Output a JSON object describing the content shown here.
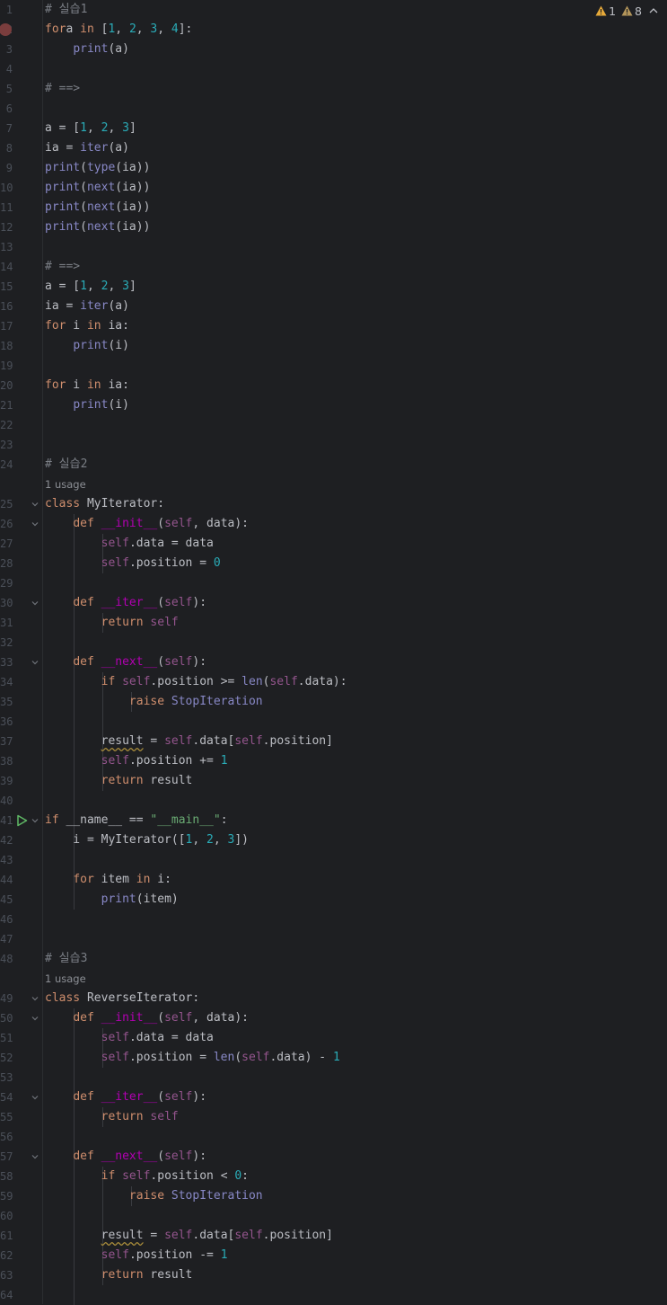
{
  "inspections": {
    "warnings": "1",
    "weak_warnings": "8"
  },
  "hints": {
    "usage": "1 usage"
  },
  "lines": [
    {
      "n": "1",
      "t": [
        [
          "cm",
          "# 실습1"
        ]
      ]
    },
    {
      "n": "2",
      "t": [
        [
          "kw",
          "for"
        ],
        [
          "",
          "a "
        ],
        [
          "kw",
          "in"
        ],
        [
          "",
          " ["
        ],
        [
          "nm",
          "1"
        ],
        [
          "",
          ", "
        ],
        [
          "nm",
          "2"
        ],
        [
          "",
          ", "
        ],
        [
          "nm",
          "3"
        ],
        [
          "",
          ", "
        ],
        [
          "nm",
          "4"
        ],
        [
          "",
          "]:"
        ]
      ]
    },
    {
      "n": "3",
      "t": [
        [
          "",
          "    "
        ],
        [
          "bi",
          "print"
        ],
        [
          "",
          "(a)"
        ]
      ]
    },
    {
      "n": "4",
      "t": []
    },
    {
      "n": "5",
      "t": [
        [
          "cm",
          "# ==>"
        ]
      ]
    },
    {
      "n": "6",
      "t": []
    },
    {
      "n": "7",
      "t": [
        [
          "",
          "a = ["
        ],
        [
          "nm",
          "1"
        ],
        [
          "",
          ", "
        ],
        [
          "nm",
          "2"
        ],
        [
          "",
          ", "
        ],
        [
          "nm",
          "3"
        ],
        [
          "",
          "]"
        ]
      ]
    },
    {
      "n": "8",
      "t": [
        [
          "",
          "ia = "
        ],
        [
          "bi",
          "iter"
        ],
        [
          "",
          "(a)"
        ]
      ]
    },
    {
      "n": "9",
      "t": [
        [
          "bi",
          "print"
        ],
        [
          "",
          "("
        ],
        [
          "bi",
          "type"
        ],
        [
          "",
          "(ia))"
        ]
      ]
    },
    {
      "n": "10",
      "t": [
        [
          "bi",
          "print"
        ],
        [
          "",
          "("
        ],
        [
          "bi",
          "next"
        ],
        [
          "",
          "(ia))"
        ]
      ]
    },
    {
      "n": "11",
      "t": [
        [
          "bi",
          "print"
        ],
        [
          "",
          "("
        ],
        [
          "bi",
          "next"
        ],
        [
          "",
          "(ia))"
        ]
      ]
    },
    {
      "n": "12",
      "t": [
        [
          "bi",
          "print"
        ],
        [
          "",
          "("
        ],
        [
          "bi",
          "next"
        ],
        [
          "",
          "(ia))"
        ]
      ]
    },
    {
      "n": "13",
      "t": []
    },
    {
      "n": "14",
      "t": [
        [
          "cm",
          "# ==>"
        ]
      ]
    },
    {
      "n": "15",
      "t": [
        [
          "",
          "a = ["
        ],
        [
          "nm",
          "1"
        ],
        [
          "",
          ", "
        ],
        [
          "nm",
          "2"
        ],
        [
          "",
          ", "
        ],
        [
          "nm",
          "3"
        ],
        [
          "",
          "]"
        ]
      ]
    },
    {
      "n": "16",
      "t": [
        [
          "",
          "ia = "
        ],
        [
          "bi",
          "iter"
        ],
        [
          "",
          "(a)"
        ]
      ]
    },
    {
      "n": "17",
      "t": [
        [
          "kw",
          "for"
        ],
        [
          "",
          " i "
        ],
        [
          "kw",
          "in"
        ],
        [
          "",
          " ia:"
        ]
      ]
    },
    {
      "n": "18",
      "t": [
        [
          "",
          "    "
        ],
        [
          "bi",
          "print"
        ],
        [
          "",
          "(i)"
        ]
      ]
    },
    {
      "n": "19",
      "t": []
    },
    {
      "n": "20",
      "t": [
        [
          "kw",
          "for"
        ],
        [
          "",
          " i "
        ],
        [
          "kw",
          "in"
        ],
        [
          "",
          " ia:"
        ]
      ]
    },
    {
      "n": "21",
      "t": [
        [
          "",
          "    "
        ],
        [
          "bi",
          "print"
        ],
        [
          "",
          "(i)"
        ]
      ]
    },
    {
      "n": "22",
      "t": []
    },
    {
      "n": "23",
      "t": []
    },
    {
      "n": "24",
      "t": [
        [
          "cm",
          "# 실습2"
        ]
      ]
    },
    {
      "n": "25",
      "t": [
        [
          "kw",
          "class"
        ],
        [
          "",
          " MyIterator:"
        ]
      ]
    },
    {
      "n": "26",
      "t": [
        [
          "",
          "    "
        ],
        [
          "kw",
          "def"
        ],
        [
          "",
          " "
        ],
        [
          "dn",
          "__init__"
        ],
        [
          "",
          "("
        ],
        [
          "sf",
          "self"
        ],
        [
          "",
          ", data):"
        ]
      ]
    },
    {
      "n": "27",
      "t": [
        [
          "",
          "        "
        ],
        [
          "sf",
          "self"
        ],
        [
          "",
          ".data = data"
        ]
      ]
    },
    {
      "n": "28",
      "t": [
        [
          "",
          "        "
        ],
        [
          "sf",
          "self"
        ],
        [
          "",
          ".position = "
        ],
        [
          "nm",
          "0"
        ]
      ]
    },
    {
      "n": "29",
      "t": []
    },
    {
      "n": "30",
      "t": [
        [
          "",
          "    "
        ],
        [
          "kw",
          "def"
        ],
        [
          "",
          " "
        ],
        [
          "dn",
          "__iter__"
        ],
        [
          "",
          "("
        ],
        [
          "sf",
          "self"
        ],
        [
          "",
          "):"
        ]
      ]
    },
    {
      "n": "31",
      "t": [
        [
          "",
          "        "
        ],
        [
          "kw",
          "return"
        ],
        [
          "",
          " "
        ],
        [
          "sf",
          "self"
        ]
      ]
    },
    {
      "n": "32",
      "t": []
    },
    {
      "n": "33",
      "t": [
        [
          "",
          "    "
        ],
        [
          "kw",
          "def"
        ],
        [
          "",
          " "
        ],
        [
          "dn",
          "__next__"
        ],
        [
          "",
          "("
        ],
        [
          "sf",
          "self"
        ],
        [
          "",
          "):"
        ]
      ]
    },
    {
      "n": "34",
      "t": [
        [
          "",
          "        "
        ],
        [
          "kw",
          "if"
        ],
        [
          "",
          " "
        ],
        [
          "sf",
          "self"
        ],
        [
          "",
          ".position >= "
        ],
        [
          "bi",
          "len"
        ],
        [
          "",
          "("
        ],
        [
          "sf",
          "self"
        ],
        [
          "",
          ".data):"
        ]
      ]
    },
    {
      "n": "35",
      "t": [
        [
          "",
          "            "
        ],
        [
          "kw",
          "raise"
        ],
        [
          "",
          " "
        ],
        [
          "bi",
          "StopIteration"
        ]
      ]
    },
    {
      "n": "36",
      "t": []
    },
    {
      "n": "37",
      "t": [
        [
          "",
          "        "
        ],
        [
          "sq",
          "result"
        ],
        [
          "",
          " = "
        ],
        [
          "sf",
          "self"
        ],
        [
          "",
          ".data["
        ],
        [
          "sf",
          "self"
        ],
        [
          "",
          ".position]"
        ]
      ]
    },
    {
      "n": "38",
      "t": [
        [
          "",
          "        "
        ],
        [
          "sf",
          "self"
        ],
        [
          "",
          ".position += "
        ],
        [
          "nm",
          "1"
        ]
      ]
    },
    {
      "n": "39",
      "t": [
        [
          "",
          "        "
        ],
        [
          "kw",
          "return"
        ],
        [
          "",
          " result"
        ]
      ]
    },
    {
      "n": "40",
      "t": []
    },
    {
      "n": "41",
      "t": [
        [
          "kw",
          "if"
        ],
        [
          "",
          " __name__ == "
        ],
        [
          "str",
          "\"__main__\""
        ],
        [
          "",
          ":"
        ]
      ]
    },
    {
      "n": "42",
      "t": [
        [
          "",
          "    i = MyIterator(["
        ],
        [
          "nm",
          "1"
        ],
        [
          "",
          ", "
        ],
        [
          "nm",
          "2"
        ],
        [
          "",
          ", "
        ],
        [
          "nm",
          "3"
        ],
        [
          "",
          "])"
        ]
      ]
    },
    {
      "n": "43",
      "t": []
    },
    {
      "n": "44",
      "t": [
        [
          "",
          "    "
        ],
        [
          "kw",
          "for"
        ],
        [
          "",
          " item "
        ],
        [
          "kw",
          "in"
        ],
        [
          "",
          " i:"
        ]
      ]
    },
    {
      "n": "45",
      "t": [
        [
          "",
          "        "
        ],
        [
          "bi",
          "print"
        ],
        [
          "",
          "(item)"
        ]
      ]
    },
    {
      "n": "46",
      "t": []
    },
    {
      "n": "47",
      "t": []
    },
    {
      "n": "48",
      "t": [
        [
          "cm",
          "# 실습3"
        ]
      ]
    },
    {
      "n": "49",
      "t": [
        [
          "kw",
          "class"
        ],
        [
          "",
          " ReverseIterator:"
        ]
      ]
    },
    {
      "n": "50",
      "t": [
        [
          "",
          "    "
        ],
        [
          "kw",
          "def"
        ],
        [
          "",
          " "
        ],
        [
          "dn",
          "__init__"
        ],
        [
          "",
          "("
        ],
        [
          "sf",
          "self"
        ],
        [
          "",
          ", data):"
        ]
      ]
    },
    {
      "n": "51",
      "t": [
        [
          "",
          "        "
        ],
        [
          "sf",
          "self"
        ],
        [
          "",
          ".data = data"
        ]
      ]
    },
    {
      "n": "52",
      "t": [
        [
          "",
          "        "
        ],
        [
          "sf",
          "self"
        ],
        [
          "",
          ".position = "
        ],
        [
          "bi",
          "len"
        ],
        [
          "",
          "("
        ],
        [
          "sf",
          "self"
        ],
        [
          "",
          ".data) - "
        ],
        [
          "nm",
          "1"
        ]
      ]
    },
    {
      "n": "53",
      "t": []
    },
    {
      "n": "54",
      "t": [
        [
          "",
          "    "
        ],
        [
          "kw",
          "def"
        ],
        [
          "",
          " "
        ],
        [
          "dn",
          "__iter__"
        ],
        [
          "",
          "("
        ],
        [
          "sf",
          "self"
        ],
        [
          "",
          "):"
        ]
      ]
    },
    {
      "n": "55",
      "t": [
        [
          "",
          "        "
        ],
        [
          "kw",
          "return"
        ],
        [
          "",
          " "
        ],
        [
          "sf",
          "self"
        ]
      ]
    },
    {
      "n": "56",
      "t": []
    },
    {
      "n": "57",
      "t": [
        [
          "",
          "    "
        ],
        [
          "kw",
          "def"
        ],
        [
          "",
          " "
        ],
        [
          "dn",
          "__next__"
        ],
        [
          "",
          "("
        ],
        [
          "sf",
          "self"
        ],
        [
          "",
          "):"
        ]
      ]
    },
    {
      "n": "58",
      "t": [
        [
          "",
          "        "
        ],
        [
          "kw",
          "if"
        ],
        [
          "",
          " "
        ],
        [
          "sf",
          "self"
        ],
        [
          "",
          ".position < "
        ],
        [
          "nm",
          "0"
        ],
        [
          "",
          ":"
        ]
      ]
    },
    {
      "n": "59",
      "t": [
        [
          "",
          "            "
        ],
        [
          "kw",
          "raise"
        ],
        [
          "",
          " "
        ],
        [
          "bi",
          "StopIteration"
        ]
      ]
    },
    {
      "n": "60",
      "t": []
    },
    {
      "n": "61",
      "t": [
        [
          "",
          "        "
        ],
        [
          "sq",
          "result"
        ],
        [
          "",
          " = "
        ],
        [
          "sf",
          "self"
        ],
        [
          "",
          ".data["
        ],
        [
          "sf",
          "self"
        ],
        [
          "",
          ".position]"
        ]
      ]
    },
    {
      "n": "62",
      "t": [
        [
          "",
          "        "
        ],
        [
          "sf",
          "self"
        ],
        [
          "",
          ".position -= "
        ],
        [
          "nm",
          "1"
        ]
      ]
    },
    {
      "n": "63",
      "t": [
        [
          "",
          "        "
        ],
        [
          "kw",
          "return"
        ],
        [
          "",
          " result"
        ]
      ]
    },
    {
      "n": "64",
      "t": []
    }
  ]
}
